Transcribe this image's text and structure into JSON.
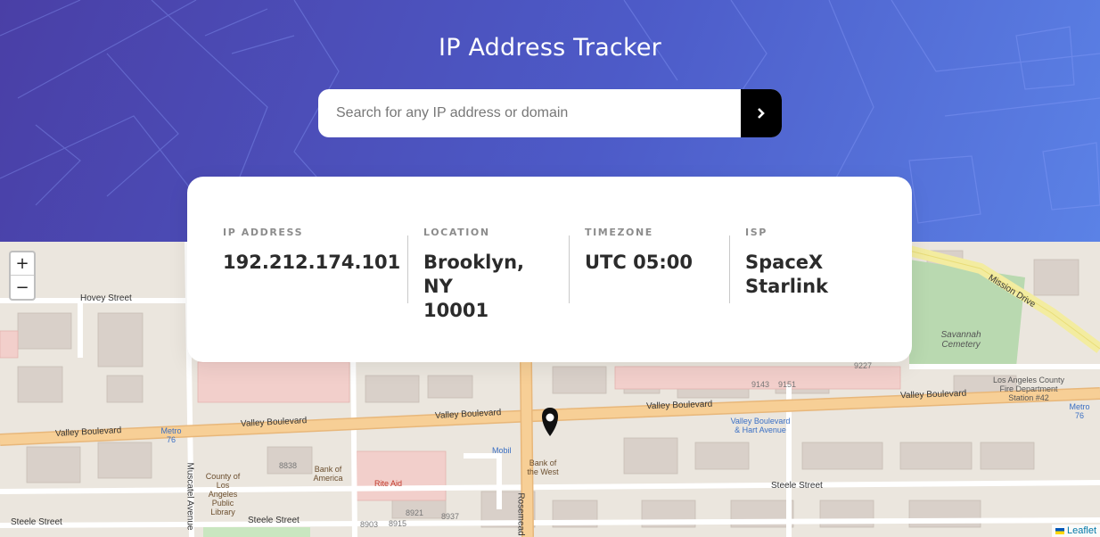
{
  "header": {
    "title": "IP Address Tracker"
  },
  "search": {
    "placeholder": "Search for any IP address or domain",
    "button_icon": "chevron-right-icon"
  },
  "info": {
    "ip_label": "IP Address",
    "ip_value": "192.212.174.101",
    "location_label": "Location",
    "location_value_line1": "Brooklyn, NY",
    "location_value_line2": "10001",
    "timezone_label": "Timezone",
    "timezone_value": "UTC 05:00",
    "isp_label": "ISP",
    "isp_value_line1": "SpaceX",
    "isp_value_line2": "Starlink"
  },
  "map": {
    "zoom_in": "+",
    "zoom_out": "−",
    "attribution": "Leaflet",
    "labels": {
      "hovey_street": "Hovey Street",
      "valley_blvd_left": "Valley Boulevard",
      "valley_blvd_mid": "Valley Boulevard",
      "valley_blvd_center": "Valley Boulevard",
      "valley_blvd_right": "Valley Boulevard",
      "mission_drive": "Mission Drive",
      "savannah_cemetery": "Savannah Cemetery",
      "steele_street_left": "Steele Street",
      "steele_street_mid": "Steele Street",
      "steele_street_right": "Steele Street",
      "county_library": "County of Los Angeles Public Library",
      "bank_of_america": "Bank of America",
      "rite_aid": "Rite Aid",
      "bank_of_the_west": "Bank of the West",
      "mobil": "Mobil",
      "metro_76_left": "Metro 76",
      "metro_76_right": "Metro 76",
      "valley_hart": "Valley Boulevard & Hart Avenue",
      "fire_station": "Los Angeles County Fire Department Station #42",
      "muscatel_avenue": "Muscatel Avenue",
      "rosemead": "Rosemead",
      "num_8838": "8838",
      "num_9143": "9143",
      "num_9151": "9151",
      "num_9227": "9227",
      "num_8921": "8921",
      "num_8937": "8937",
      "num_8903": "8903",
      "num_8915": "8915"
    }
  },
  "colors": {
    "hero_start": "#4a3fa6",
    "hero_end": "#5b82e6",
    "search_button": "#000000",
    "road_major": "#f5c98a",
    "park": "#b9d9b0",
    "commercial": "#f4c7c3"
  }
}
